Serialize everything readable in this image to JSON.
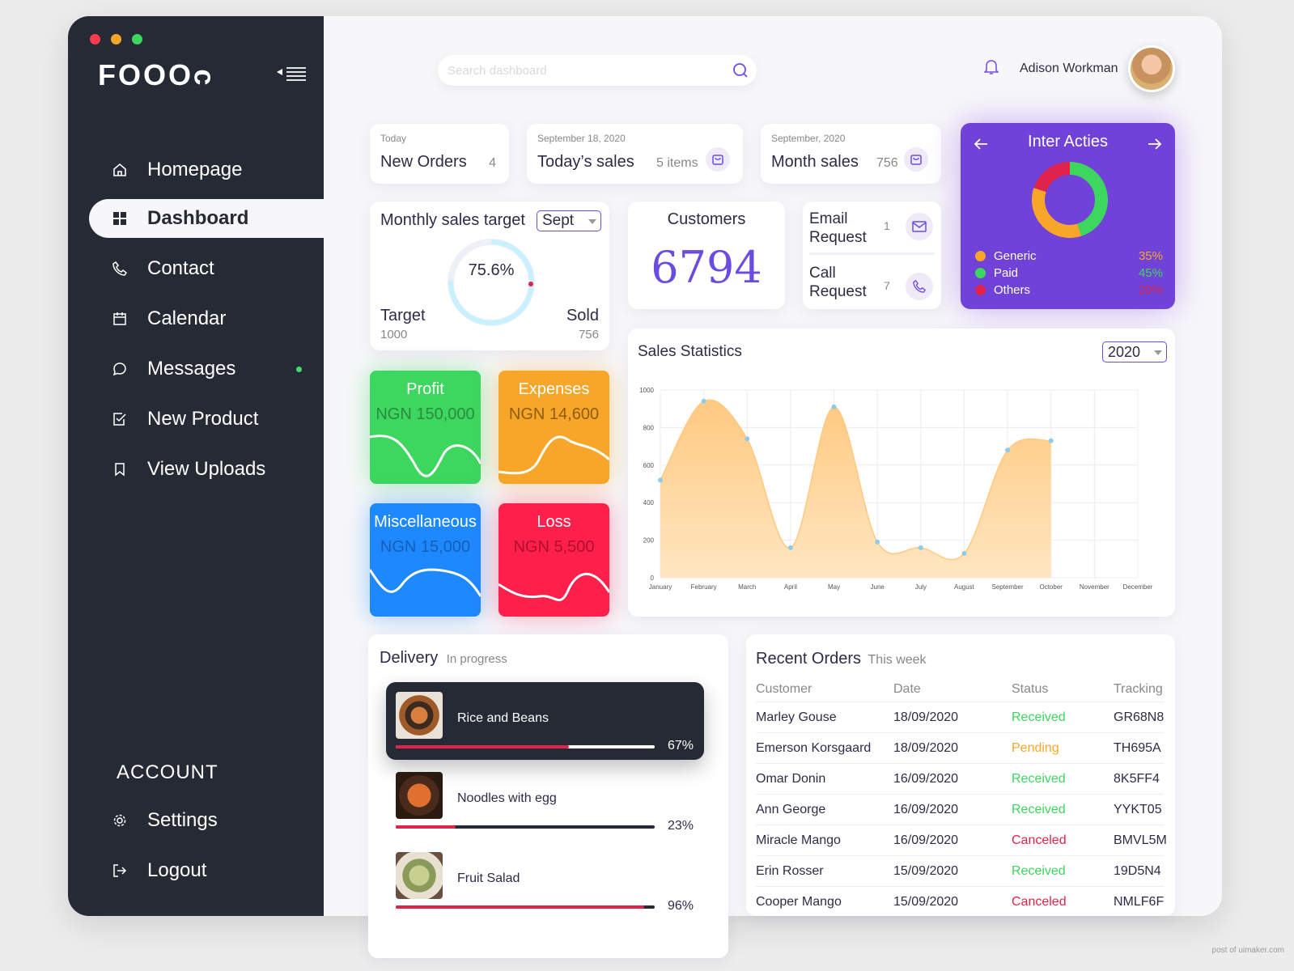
{
  "window": {
    "dot_colors": [
      "#fe3b4f",
      "#f7a629",
      "#3dd65f"
    ]
  },
  "sidebar": {
    "logo": "FOOOᴒ",
    "items": [
      {
        "label": "Homepage",
        "icon": "home-icon"
      },
      {
        "label": "Dashboard",
        "icon": "grid-icon"
      },
      {
        "label": "Contact",
        "icon": "phone-icon"
      },
      {
        "label": "Calendar",
        "icon": "calendar-icon"
      },
      {
        "label": "Messages",
        "icon": "message-icon"
      },
      {
        "label": "New Product",
        "icon": "checkbox-icon"
      },
      {
        "label": "View Uploads",
        "icon": "bookmark-icon"
      }
    ],
    "account_label": "ACCOUNT",
    "account_items": [
      {
        "label": "Settings",
        "icon": "gear-icon"
      },
      {
        "label": "Logout",
        "icon": "logout-icon"
      }
    ]
  },
  "header": {
    "search_placeholder": "Search dashboard",
    "user_name": "Adison Workman"
  },
  "stats": {
    "new_orders": {
      "caption": "Today",
      "title": "New Orders",
      "value": "4"
    },
    "todays_sales": {
      "caption": "September 18, 2020",
      "title": "Today’s sales",
      "value": "5 items"
    },
    "month_sales": {
      "caption": "September, 2020",
      "title": "Month sales",
      "value": "756"
    }
  },
  "inter_acties": {
    "title": "Inter Acties",
    "legend": [
      {
        "label": "Generic",
        "value": "35%",
        "color": "#f7a629"
      },
      {
        "label": "Paid",
        "value": "45%",
        "color": "#3dd65f"
      },
      {
        "label": "Others",
        "value": "20%",
        "color": "#e0234c"
      }
    ]
  },
  "monthly_target": {
    "title": "Monthly sales target",
    "month": "Sept",
    "percent": "75.6%",
    "target_label": "Target",
    "target_value": "1000",
    "sold_label": "Sold",
    "sold_value": "756"
  },
  "customers": {
    "title": "Customers",
    "value": "6794"
  },
  "requests": {
    "email": {
      "label_line1": "Email",
      "label_line2": "Request",
      "value": "1"
    },
    "call": {
      "label_line1": "Call",
      "label_line2": "Request",
      "value": "7"
    }
  },
  "finance": {
    "profit": {
      "title": "Profit",
      "value": "NGN 150,000",
      "color": "#3dd65f"
    },
    "expenses": {
      "title": "Expenses",
      "value": "NGN 14,600",
      "color": "#f7a629"
    },
    "misc": {
      "title": "Miscellaneous",
      "value": "NGN 15,000",
      "color": "#1e88ff"
    },
    "loss": {
      "title": "Loss",
      "value": "NGN 5,500",
      "color": "#fe1f4a"
    }
  },
  "sales_stats": {
    "title": "Sales Statistics",
    "year": "2020"
  },
  "chart_data": {
    "type": "area",
    "title": "Sales Statistics",
    "categories": [
      "January",
      "February",
      "March",
      "April",
      "May",
      "June",
      "July",
      "August",
      "September",
      "October",
      "November",
      "December"
    ],
    "values": [
      520,
      940,
      740,
      160,
      910,
      190,
      160,
      130,
      680,
      730,
      null,
      null
    ],
    "yticks": [
      0,
      200,
      400,
      600,
      800,
      1000
    ],
    "ylim": [
      0,
      1000
    ],
    "grid": true
  },
  "delivery": {
    "title": "Delivery",
    "subtitle": "In progress",
    "items": [
      {
        "name": "Rice and Beans",
        "percent": "67%",
        "progress": 0.67
      },
      {
        "name": "Noodles with egg",
        "percent": "23%",
        "progress": 0.23
      },
      {
        "name": "Fruit Salad",
        "percent": "96%",
        "progress": 0.96
      }
    ]
  },
  "recent_orders": {
    "title": "Recent Orders",
    "subtitle": "This week",
    "headers": [
      "Customer",
      "Date",
      "Status",
      "Tracking"
    ],
    "rows": [
      {
        "customer": "Marley Gouse",
        "date": "18/09/2020",
        "status": "Received",
        "tracking": "GR68N8"
      },
      {
        "customer": "Emerson Korsgaard",
        "date": "18/09/2020",
        "status": "Pending",
        "tracking": "TH695A"
      },
      {
        "customer": "Omar Donin",
        "date": "16/09/2020",
        "status": "Received",
        "tracking": "8K5FF4"
      },
      {
        "customer": "Ann George",
        "date": "16/09/2020",
        "status": "Received",
        "tracking": "YYKT05"
      },
      {
        "customer": "Miracle Mango",
        "date": "16/09/2020",
        "status": "Canceled",
        "tracking": "BMVL5M"
      },
      {
        "customer": "Erin Rosser",
        "date": "15/09/2020",
        "status": "Received",
        "tracking": "19D5N4"
      },
      {
        "customer": "Cooper Mango",
        "date": "15/09/2020",
        "status": "Canceled",
        "tracking": "NMLF6F"
      }
    ],
    "status_colors": {
      "Received": "#3dd65f",
      "Pending": "#f7a629",
      "Canceled": "#e0234c"
    }
  },
  "watermark": "post of uimaker.com"
}
